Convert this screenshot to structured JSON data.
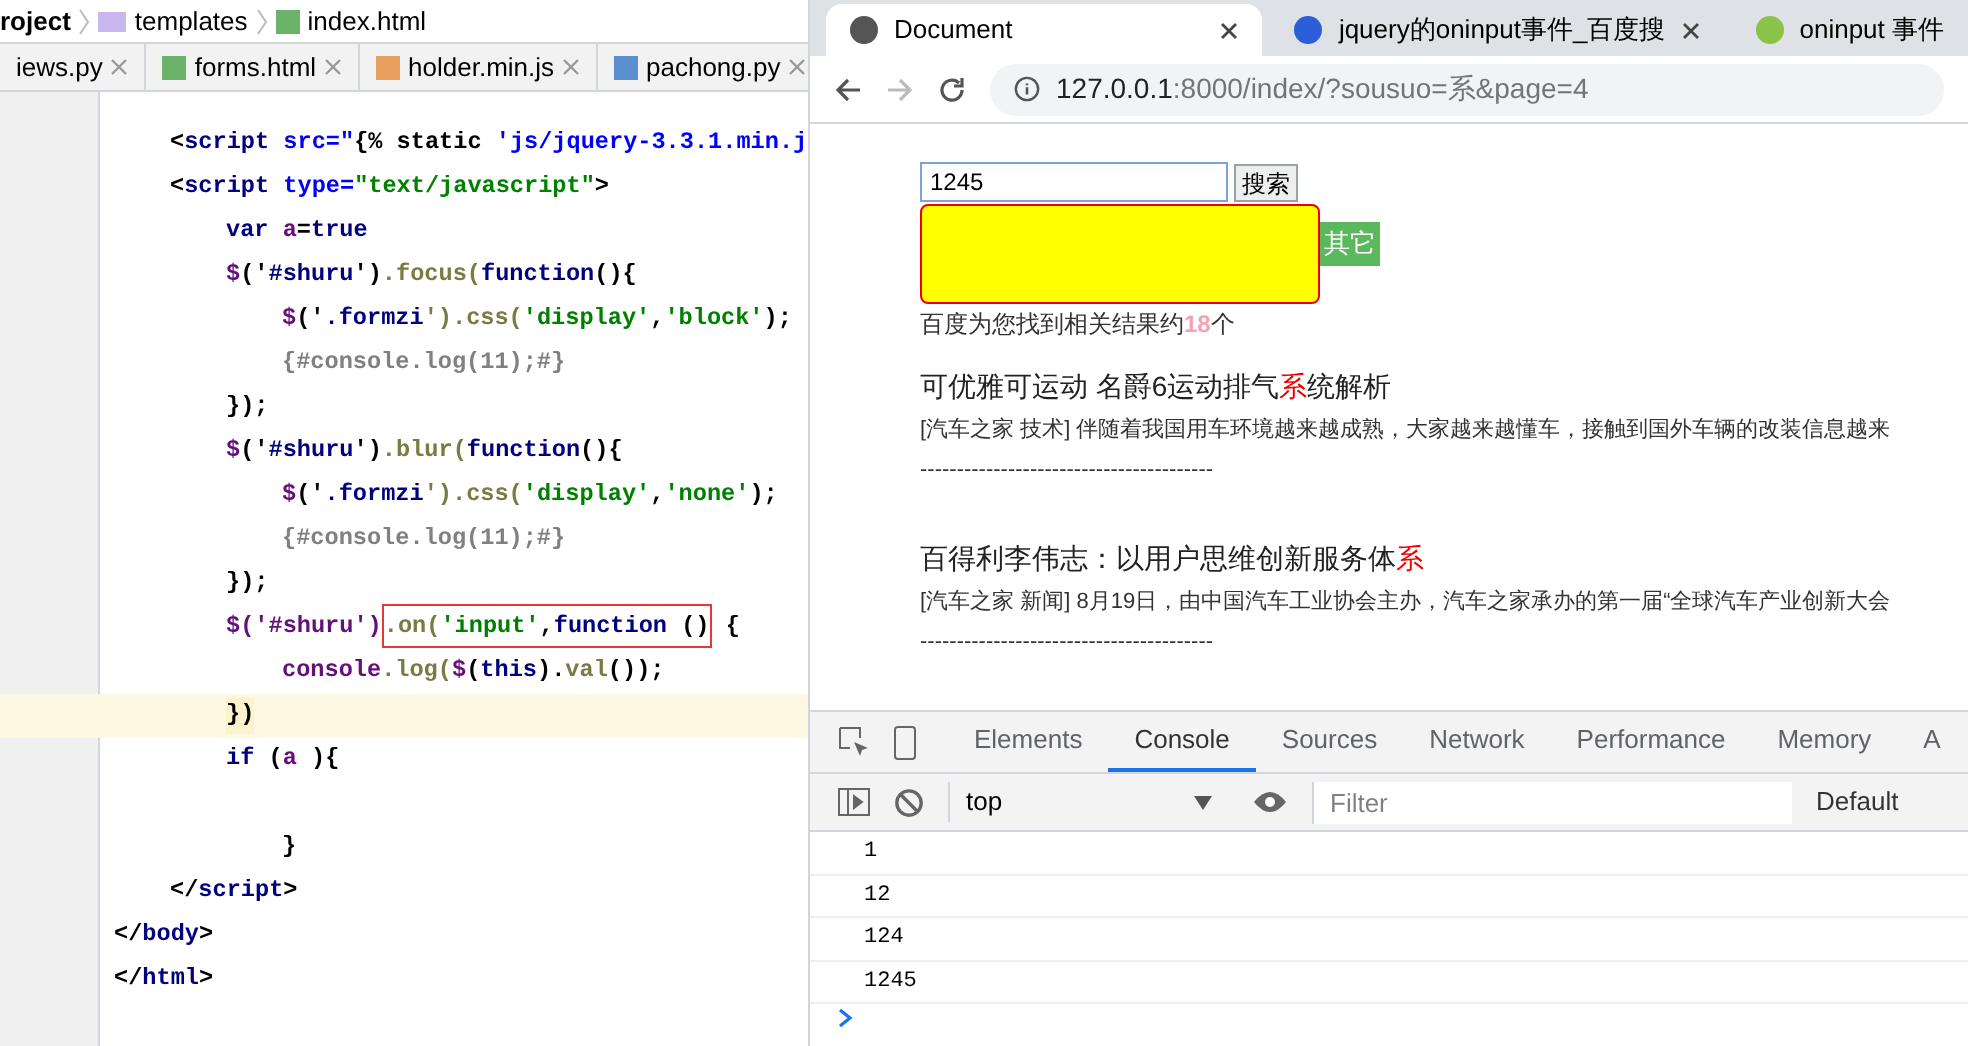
{
  "editor": {
    "breadcrumbs": [
      "roject",
      "templates",
      "index.html"
    ],
    "tabs": [
      {
        "label": "iews.py",
        "selected": false
      },
      {
        "label": "forms.html",
        "selected": false
      },
      {
        "label": "holder.min.js",
        "selected": false
      },
      {
        "label": "pachong.py",
        "selected": false
      }
    ],
    "lines": [
      {
        "children": [
          {
            "current": false,
            "segments": [
              {
                "text": "<",
                "color": "#000000"
              },
              {
                "text": "script",
                "color": "#000080"
              },
              {
                "text": " src=\"",
                "color": "#0000ff"
              },
              {
                "text": "{% static ",
                "color": "#000000"
              },
              {
                "text": "'js/jquery-3.3.1.min.j",
                "color": "#0000ff"
              }
            ]
          },
          {
            "current": false,
            "segments": [
              {
                "text": "<",
                "color": "#000000"
              },
              {
                "text": "script",
                "color": "#000080"
              },
              {
                "text": " type=",
                "color": "#0000ff"
              },
              {
                "text": "\"text/javascript\"",
                "color": "#008000"
              },
              {
                "text": ">",
                "color": "#000000"
              }
            ],
            "children": [
              {
                "current": false,
                "segments": [
                  {
                    "text": "var ",
                    "color": "#000080"
                  },
                  {
                    "text": "a",
                    "color": "#660e7a"
                  },
                  {
                    "text": "=",
                    "color": "#000000"
                  },
                  {
                    "text": "true",
                    "color": "#000080"
                  }
                ]
              },
              {
                "current": false,
                "segments": [
                  {
                    "text": "$",
                    "color": "#660e7a"
                  },
                  {
                    "text": "('",
                    "color": "#000000"
                  },
                  {
                    "text": "#shuru",
                    "color": "#000080"
                  },
                  {
                    "text": "')",
                    "color": "#000000"
                  },
                  {
                    "text": ".focus(",
                    "color": "#7a7a43"
                  },
                  {
                    "text": "function",
                    "color": "#000080"
                  },
                  {
                    "text": "(){",
                    "color": "#000000"
                  }
                ],
                "children": [
                  {
                    "current": false,
                    "segments": [
                      {
                        "text": "$",
                        "color": "#660e7a"
                      },
                      {
                        "text": "('",
                        "color": "#000000"
                      },
                      {
                        "text": ".formzi",
                        "color": "#000080"
                      },
                      {
                        "text": "').css(",
                        "color": "#7a7a43"
                      },
                      {
                        "text": "'display'",
                        "color": "#008000"
                      },
                      {
                        "text": ",",
                        "color": "#000000"
                      },
                      {
                        "text": "'block'",
                        "color": "#008000"
                      },
                      {
                        "text": ");",
                        "color": "#000000"
                      }
                    ]
                  },
                  {
                    "current": false,
                    "segments": [
                      {
                        "text": "{#console.log(11);#}",
                        "color": "#808080"
                      }
                    ]
                  }
                ]
              },
              {
                "current": false,
                "segments": [
                  {
                    "text": "});",
                    "color": "#000000"
                  }
                ]
              },
              {
                "current": false,
                "segments": [
                  {
                    "text": "$",
                    "color": "#660e7a"
                  },
                  {
                    "text": "('",
                    "color": "#000000"
                  },
                  {
                    "text": "#shuru",
                    "color": "#000080"
                  },
                  {
                    "text": "')",
                    "color": "#000000"
                  },
                  {
                    "text": ".blur(",
                    "color": "#7a7a43"
                  },
                  {
                    "text": "function",
                    "color": "#000080"
                  },
                  {
                    "text": "(){",
                    "color": "#000000"
                  }
                ],
                "children": [
                  {
                    "current": false,
                    "segments": [
                      {
                        "text": "$",
                        "color": "#660e7a"
                      },
                      {
                        "text": "('",
                        "color": "#000000"
                      },
                      {
                        "text": ".formzi",
                        "color": "#000080"
                      },
                      {
                        "text": "').css(",
                        "color": "#7a7a43"
                      },
                      {
                        "text": "'display'",
                        "color": "#008000"
                      },
                      {
                        "text": ",",
                        "color": "#000000"
                      },
                      {
                        "text": "'none'",
                        "color": "#008000"
                      },
                      {
                        "text": ");",
                        "color": "#000000"
                      }
                    ]
                  },
                  {
                    "current": false,
                    "segments": [
                      {
                        "text": "{#console.log(11);#}",
                        "color": "#808080"
                      }
                    ]
                  }
                ]
              },
              {
                "current": false,
                "segments": [
                  {
                    "text": "});",
                    "color": "#000000"
                  }
                ]
              },
              {
                "current": false,
                "segments": [
                  {
                    "text": "$('#shuru')",
                    "color": "#660e7a",
                    "framed": false
                  },
                  {
                    "text": ".on(",
                    "color": "#7a7a43",
                    "framed": true
                  },
                  {
                    "text": "'input'",
                    "color": "#008000",
                    "framed": true
                  },
                  {
                    "text": ",",
                    "color": "#000000",
                    "framed": true
                  },
                  {
                    "text": "function",
                    "color": "#000080",
                    "framed": true
                  },
                  {
                    "text": " ()",
                    "color": "#000000",
                    "framed": true
                  },
                  {
                    "text": " {",
                    "color": "#000000",
                    "framed": false
                  }
                ],
                "children": [
                  {
                    "current": false,
                    "segments": [
                      {
                        "text": "console",
                        "color": "#660e7a"
                      },
                      {
                        "text": ".log(",
                        "color": "#7a7a43"
                      },
                      {
                        "text": "$",
                        "color": "#660e7a"
                      },
                      {
                        "text": "(",
                        "color": "#000000"
                      },
                      {
                        "text": "this",
                        "color": "#000080"
                      },
                      {
                        "text": ").",
                        "color": "#000000"
                      },
                      {
                        "text": "val",
                        "color": "#7a7a43"
                      },
                      {
                        "text": "());",
                        "color": "#000000"
                      }
                    ]
                  }
                ]
              },
              {
                "current": true,
                "segments": [
                  {
                    "text": "})",
                    "color": "#000000"
                  }
                ]
              },
              {
                "current": false,
                "segments": [
                  {
                    "text": "if ",
                    "color": "#000080"
                  },
                  {
                    "text": "(",
                    "color": "#000000"
                  },
                  {
                    "text": "a",
                    "color": "#660e7a"
                  },
                  {
                    "text": " ){",
                    "color": "#000000"
                  }
                ],
                "children": [
                  {
                    "current": false
                  },
                  {
                    "current": false,
                    "segments": [
                      {
                        "text": "}",
                        "color": "#000000"
                      }
                    ]
                  }
                ]
              }
            ]
          },
          {
            "current": false,
            "segments": [
              {
                "text": "</",
                "color": "#000000"
              },
              {
                "text": "script",
                "color": "#000080"
              },
              {
                "text": ">",
                "color": "#000000"
              }
            ]
          }
        ]
      },
      {
        "current": false,
        "segments": [
          {
            "text": "</",
            "color": "#000000"
          },
          {
            "text": "body",
            "color": "#000080"
          },
          {
            "text": ">",
            "color": "#000000"
          }
        ]
      },
      {
        "current": false,
        "segments": [
          {
            "text": "</",
            "color": "#000000"
          },
          {
            "text": "html",
            "color": "#000080"
          },
          {
            "text": ">",
            "color": "#000000"
          }
        ]
      }
    ]
  },
  "browser": {
    "tabs": [
      {
        "label": "Document",
        "selected": true
      },
      {
        "label": "jquery的oninput事件_百度搜",
        "selected": false
      },
      {
        "label": "oninput 事件",
        "selected": false
      }
    ],
    "url_host": "127.0.0.1",
    "url_rest": ":8000/index/?sousuo=系&page=4",
    "page": {
      "search_value": "1245",
      "search_button": "搜索",
      "other_button": "其它",
      "result_count": [
        {
          "text": "百度为您找到相关结果约",
          "highlight": false
        },
        {
          "text": "18",
          "highlight": true
        },
        {
          "text": "个",
          "highlight": false
        }
      ],
      "results": [
        {
          "title": [
            {
              "text": "可优雅可运动 名爵6运动排气",
              "highlight": false
            },
            {
              "text": "系",
              "highlight": true
            },
            {
              "text": "统解析",
              "highlight": false
            }
          ],
          "snippet": "[汽车之家 技术] 伴随着我国用车环境越来越成熟，大家越来越懂车，接触到国外车辆的改装信息越来",
          "divider": "----------------------------------------"
        },
        {
          "title": [
            {
              "text": "百得利李伟志：以用户思维创新服务体",
              "highlight": false
            },
            {
              "text": "系",
              "highlight": true
            }
          ],
          "snippet": "[汽车之家 新闻] 8月19日，由中国汽车工业协会主办，汽车之家承办的第一届“全球汽车产业创新大会",
          "divider": "----------------------------------------"
        }
      ]
    },
    "devtools": {
      "tabs": [
        {
          "label": "Elements",
          "selected": false
        },
        {
          "label": "Console",
          "selected": true
        },
        {
          "label": "Sources",
          "selected": false
        },
        {
          "label": "Network",
          "selected": false
        },
        {
          "label": "Performance",
          "selected": false
        },
        {
          "label": "Memory",
          "selected": false
        },
        {
          "label": "A",
          "selected": false
        }
      ],
      "context": "top",
      "filter_placeholder": "Filter",
      "levels": "Default",
      "log": [
        "1",
        "12",
        "124",
        "1245"
      ]
    }
  }
}
